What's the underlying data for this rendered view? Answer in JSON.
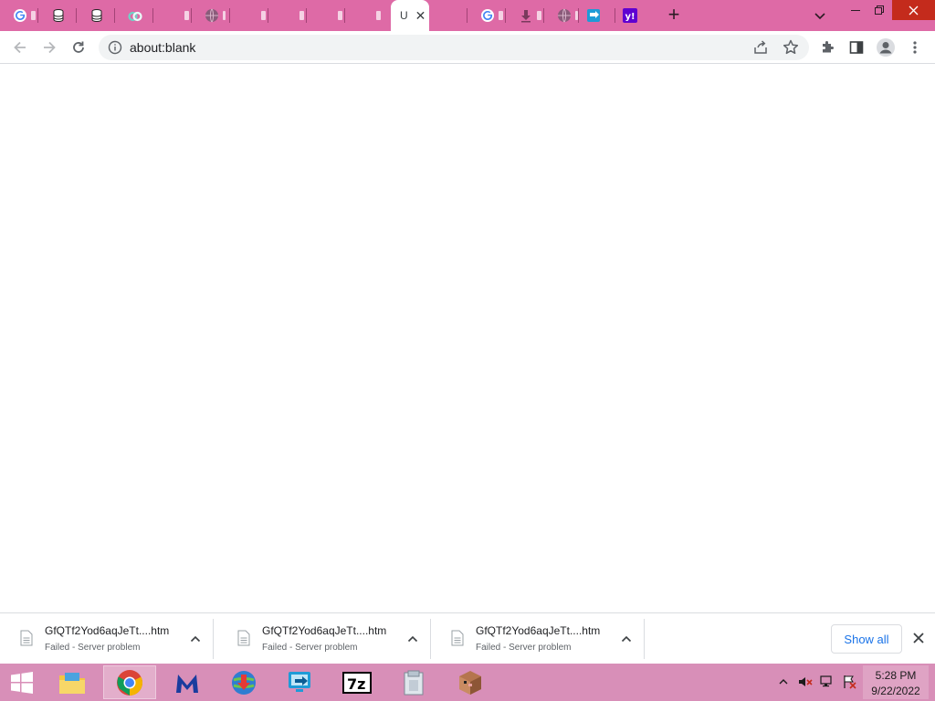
{
  "browser": {
    "tabs": [
      {
        "favicon": "google-icon"
      },
      {
        "favicon": "database-icon"
      },
      {
        "favicon": "database-icon"
      },
      {
        "favicon": "link-icon"
      },
      {
        "favicon": "blank"
      },
      {
        "favicon": "globe-icon"
      },
      {
        "favicon": "blank"
      },
      {
        "favicon": "blank"
      },
      {
        "favicon": "blank"
      },
      {
        "favicon": "blank"
      },
      {
        "favicon": "blank",
        "active": true,
        "title_fragment": "U"
      },
      {
        "favicon": "blank"
      },
      {
        "favicon": "google-icon"
      },
      {
        "favicon": "download-icon"
      },
      {
        "favicon": "globe-icon"
      },
      {
        "favicon": "remote-desktop-icon"
      },
      {
        "favicon": "yahoo-icon"
      }
    ],
    "new_tab_label": "+",
    "address_bar": {
      "url": "about:blank"
    }
  },
  "downloads": {
    "items": [
      {
        "filename": "GfQTf2Yod6aqJeTt....htm",
        "status": "Failed - Server problem"
      },
      {
        "filename": "GfQTf2Yod6aqJeTt....htm",
        "status": "Failed - Server problem"
      },
      {
        "filename": "GfQTf2Yod6aqJeTt....htm",
        "status": "Failed - Server problem"
      }
    ],
    "show_all_label": "Show all"
  },
  "taskbar": {
    "apps": [
      "windows-start-icon",
      "file-explorer-icon",
      "chrome-icon",
      "malwarebytes-icon",
      "internet-download-manager-icon",
      "remote-desktop-icon",
      "7zip-icon",
      "archive-icon",
      "minecraft-icon"
    ],
    "clock": {
      "time": "5:28 PM",
      "date": "9/22/2022"
    }
  },
  "colors": {
    "tabstrip": "#de6aa6",
    "taskbar": "#d88fb8",
    "close_button": "#c42b1c",
    "link": "#1a73e8"
  }
}
